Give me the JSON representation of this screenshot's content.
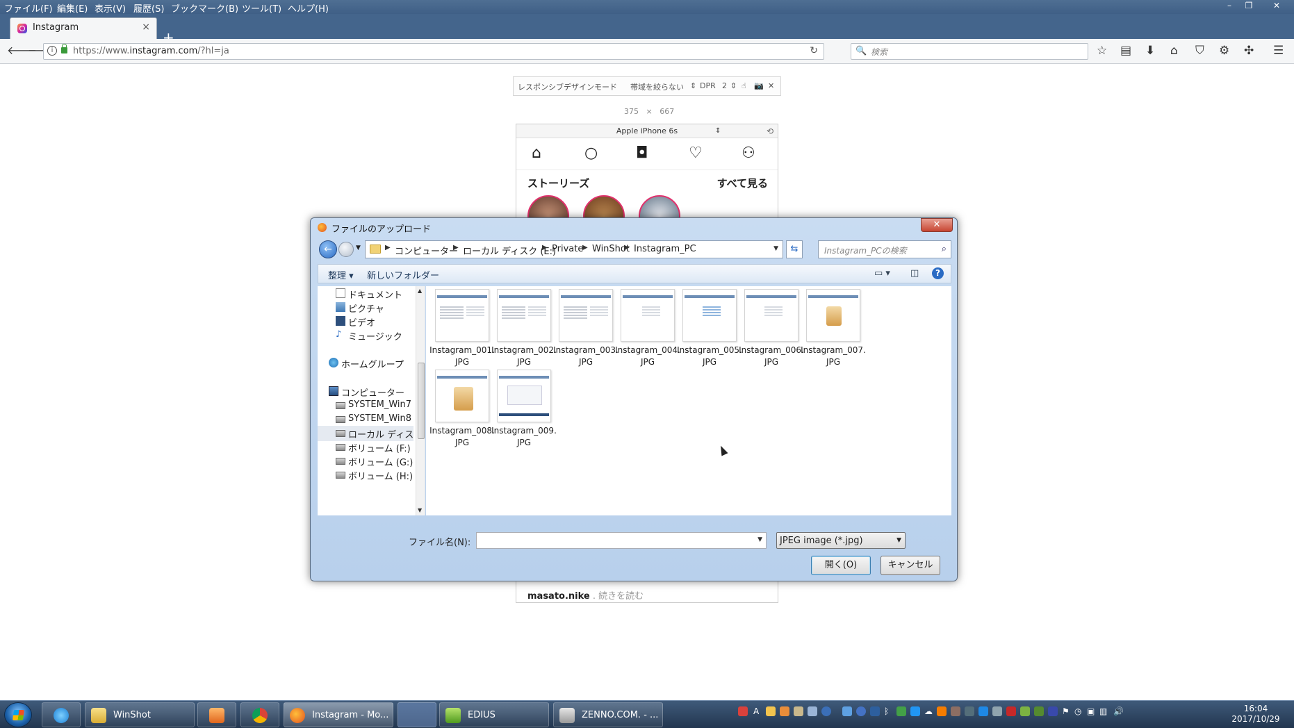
{
  "menubar": {
    "items": [
      "ファイル(F)",
      "編集(E)",
      "表示(V)",
      "履歴(S)",
      "ブックマーク(B)",
      "ツール(T)",
      "ヘルプ(H)"
    ]
  },
  "tab": {
    "title": "Instagram",
    "close": "×",
    "new": "+"
  },
  "navbar": {
    "url_prefix": "https://www.",
    "url_domain": "instagram.com",
    "url_suffix": "/?hl=ja",
    "search_placeholder": "検索"
  },
  "rdm": {
    "mode_label": "レスポンシブデザインモード",
    "throttle": "帯域を絞らない",
    "dpr_label": "DPR",
    "dpr_value": "2",
    "width": "375",
    "times": "×",
    "height": "667",
    "device": "Apple iPhone 6s"
  },
  "instagram": {
    "stories_label": "ストーリーズ",
    "see_all": "すべて見る",
    "footer_user": "masato.nike",
    "footer_more": ". 続きを読む"
  },
  "dialog": {
    "title": "ファイルのアップロード",
    "breadcrumb": [
      "コンピューター",
      "ローカル ディスク (E:)",
      "Private",
      "WinShot",
      "Instagram_PC"
    ],
    "search_placeholder": "Instagram_PCの検索",
    "organize": "整理 ▾",
    "new_folder": "新しいフォルダー",
    "nav_items": [
      {
        "label": "ドキュメント",
        "icon": "document-icon"
      },
      {
        "label": "ピクチャ",
        "icon": "pictures-icon"
      },
      {
        "label": "ビデオ",
        "icon": "video-icon"
      },
      {
        "label": "ミュージック",
        "icon": "music-icon"
      },
      {
        "label": "ホームグループ",
        "icon": "homegroup-icon"
      },
      {
        "label": "コンピューター",
        "icon": "computer-icon"
      },
      {
        "label": "SYSTEM_Win7",
        "icon": "drive-icon"
      },
      {
        "label": "SYSTEM_Win8",
        "icon": "drive-icon"
      },
      {
        "label": "ローカル ディス",
        "icon": "drive-icon"
      },
      {
        "label": "ボリューム (F:)",
        "icon": "drive-icon"
      },
      {
        "label": "ボリューム (G:)",
        "icon": "drive-icon"
      },
      {
        "label": "ボリューム (H:)",
        "icon": "drive-icon"
      }
    ],
    "files": [
      {
        "line1": "Instagram_001.",
        "line2": "JPG"
      },
      {
        "line1": "Instagram_002.",
        "line2": "JPG"
      },
      {
        "line1": "Instagram_003.",
        "line2": "JPG"
      },
      {
        "line1": "Instagram_004.",
        "line2": "JPG"
      },
      {
        "line1": "Instagram_005.",
        "line2": "JPG"
      },
      {
        "line1": "Instagram_006.",
        "line2": "JPG"
      },
      {
        "line1": "Instagram_007.",
        "line2": "JPG"
      },
      {
        "line1": "Instagram_008.",
        "line2": "JPG"
      },
      {
        "line1": "Instagram_009.",
        "line2": "JPG"
      }
    ],
    "filename_label": "ファイル名(N):",
    "filename_value": "",
    "filetype": "JPEG image (*.jpg)",
    "open_button": "開く(O)",
    "cancel_button": "キャンセル"
  },
  "taskbar": {
    "items": [
      {
        "label": "",
        "icon": "internet-explorer-icon"
      },
      {
        "label": "WinShot",
        "icon": "folder-icon"
      },
      {
        "label": "",
        "icon": "media-player-icon"
      },
      {
        "label": "",
        "icon": "chrome-icon"
      },
      {
        "label": "Instagram - Mo...",
        "icon": "firefox-icon"
      },
      {
        "label": "",
        "icon": "blank-app-icon"
      },
      {
        "label": "EDIUS",
        "icon": "edius-icon"
      },
      {
        "label": "ZENNO.COM. - ...",
        "icon": "zenno-icon"
      }
    ],
    "time": "16:04",
    "date": "2017/10/29"
  },
  "colors": {
    "titlebar": "#44658c",
    "taskbar": "#22364f",
    "dialog_frame": "#b8d0ec",
    "accent": "#2a6bc4"
  }
}
